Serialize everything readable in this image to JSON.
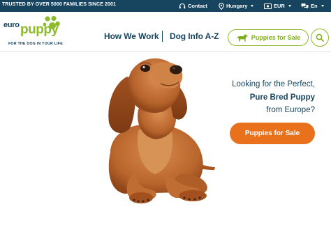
{
  "topbar": {
    "trust_text": "TRUSTED BY OVER 5000 FAMILIES SINCE 2001",
    "contact_label": "Contact",
    "country_label": "Hungary",
    "currency_label": "EUR",
    "language_label": "En",
    "background": "#17445f"
  },
  "logo": {
    "euro": "euro",
    "puppy": "puppy",
    "tagline": "FOR THE DOG IN YOUR LIFE",
    "green": "#8dbb2b",
    "navy": "#17445f"
  },
  "nav": {
    "how_we_work": "How We Work",
    "dog_info": "Dog Info A-Z",
    "puppies_for_sale": "Puppies for Sale",
    "search_icon": "search-icon",
    "dog_icon": "dog-silhouette-icon"
  },
  "hero": {
    "line1": "Looking for the Perfect,",
    "line2": "Pure Bred Puppy",
    "line3": "from Europe?",
    "cta_label": "Puppies for Sale",
    "cta_color": "#e9711c",
    "image_subject": "dachshund-puppy"
  }
}
